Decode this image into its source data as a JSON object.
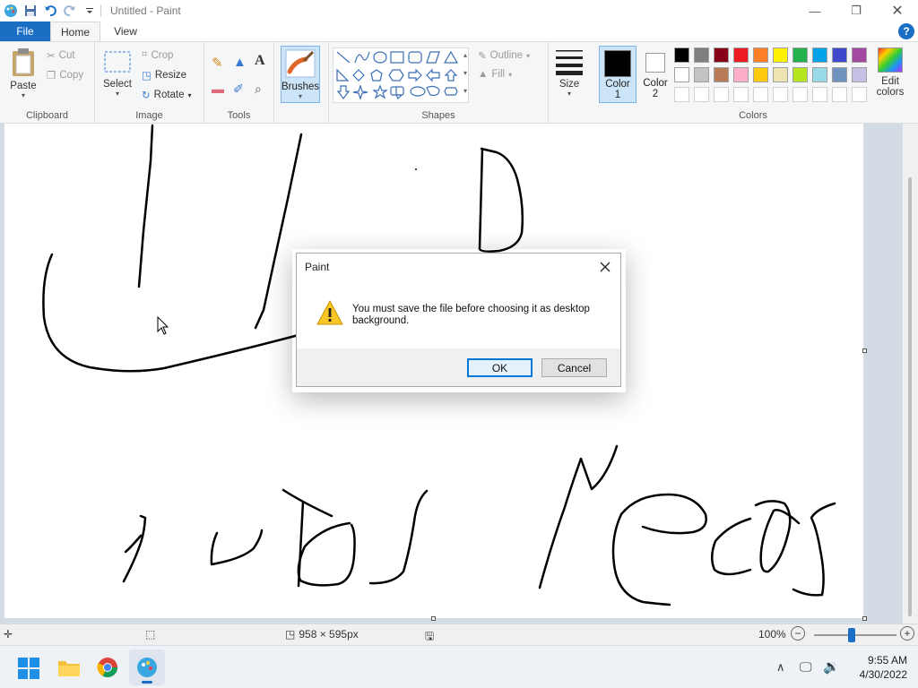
{
  "window": {
    "title": "Untitled - Paint"
  },
  "tabs": [
    {
      "label": "File"
    },
    {
      "label": "Home"
    },
    {
      "label": "View"
    }
  ],
  "ribbon": {
    "clipboard": {
      "paste": "Paste",
      "cut": "Cut",
      "copy": "Copy",
      "label": "Clipboard"
    },
    "image": {
      "select": "Select",
      "crop": "Crop",
      "resize": "Resize",
      "rotate": "Rotate",
      "label": "Image"
    },
    "tools": {
      "label": "Tools"
    },
    "brushes": "Brushes",
    "shapes": {
      "outline": "Outline",
      "fill": "Fill",
      "label": "Shapes"
    },
    "size": "Size",
    "color1": {
      "line1": "Color",
      "line2": "1"
    },
    "color2": {
      "line1": "Color",
      "line2": "2"
    },
    "colors_label": "Colors",
    "edit_colors": {
      "line1": "Edit",
      "line2": "colors"
    },
    "palette_row1": [
      "#000000",
      "#7f7f7f",
      "#880015",
      "#ed1c24",
      "#ff7f27",
      "#fff200",
      "#22b14c",
      "#00a2e8",
      "#3f48cc",
      "#a349a4"
    ],
    "palette_row2": [
      "#ffffff",
      "#c3c3c3",
      "#b97a57",
      "#ffaec9",
      "#ffc90e",
      "#efe4b0",
      "#b5e61d",
      "#99d9ea",
      "#7092be",
      "#c8bfe7"
    ]
  },
  "status": {
    "dimensions": "958 × 595px",
    "zoom": "100%"
  },
  "dialog": {
    "title": "Paint",
    "message": "You must save the file before choosing it as desktop background.",
    "ok": "OK",
    "cancel": "Cancel"
  },
  "taskbar": {
    "time": "9:55 AM",
    "date": "4/30/2022"
  }
}
